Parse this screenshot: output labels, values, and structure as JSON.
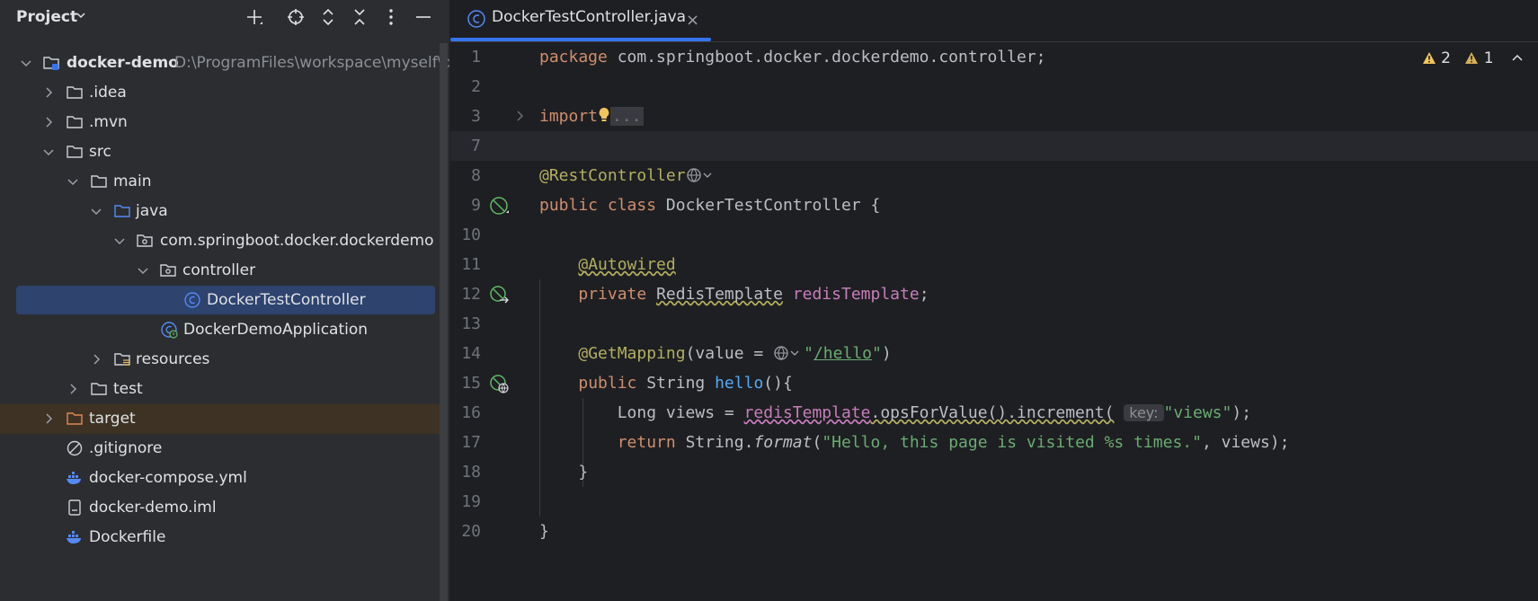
{
  "sidebar": {
    "title": "Project",
    "tree": [
      {
        "label": "docker-demo",
        "path": "D:\\ProgramFiles\\workspace\\myself\\doc",
        "icon": "module-folder-icon",
        "arrow": "down",
        "level": 0
      },
      {
        "label": ".idea",
        "icon": "folder-icon",
        "arrow": "right",
        "level": 1
      },
      {
        "label": ".mvn",
        "icon": "folder-icon",
        "arrow": "right",
        "level": 1
      },
      {
        "label": "src",
        "icon": "folder-icon",
        "arrow": "down",
        "level": 1
      },
      {
        "label": "main",
        "icon": "folder-icon",
        "arrow": "down",
        "level": 2
      },
      {
        "label": "java",
        "icon": "source-folder-icon",
        "arrow": "down",
        "level": 3
      },
      {
        "label": "com.springboot.docker.dockerdemo",
        "icon": "package-icon",
        "arrow": "down",
        "level": 4
      },
      {
        "label": "controller",
        "icon": "package-icon",
        "arrow": "down",
        "level": 5
      },
      {
        "label": "DockerTestController",
        "icon": "class-icon",
        "arrow": "none",
        "level": 6
      },
      {
        "label": "DockerDemoApplication",
        "icon": "spring-app-icon",
        "arrow": "none",
        "level": 5
      },
      {
        "label": "resources",
        "icon": "resources-folder-icon",
        "arrow": "right",
        "level": 3
      },
      {
        "label": "test",
        "icon": "folder-icon",
        "arrow": "right",
        "level": 2
      },
      {
        "label": "target",
        "icon": "excluded-folder-icon",
        "arrow": "right",
        "level": 1
      },
      {
        "label": ".gitignore",
        "icon": "gitignore-icon",
        "arrow": "none",
        "level": 1
      },
      {
        "label": "docker-compose.yml",
        "icon": "docker-icon",
        "arrow": "none",
        "level": 1
      },
      {
        "label": "docker-demo.iml",
        "icon": "iml-file-icon",
        "arrow": "none",
        "level": 1
      },
      {
        "label": "Dockerfile",
        "icon": "docker-icon",
        "arrow": "none",
        "level": 1
      }
    ]
  },
  "editor": {
    "tab_label": "DockerTestController.java",
    "tab_close": "×",
    "warnings": {
      "count_a": "2",
      "count_b": "1"
    },
    "lines": {
      "l1": {
        "num": "1",
        "kw": "package",
        "rest": " com.springboot.docker.dockerdemo.controller;"
      },
      "l2": {
        "num": "2"
      },
      "l3": {
        "num": "3",
        "kw": "import",
        "fold": "..."
      },
      "l7": {
        "num": "7"
      },
      "l8": {
        "num": "8",
        "ann": "@RestController"
      },
      "l9": {
        "num": "9",
        "kw1": "public",
        "kw2": "class",
        "name": " DockerTestController {"
      },
      "l10": {
        "num": "10"
      },
      "l11": {
        "num": "11",
        "ann": "@Autowired"
      },
      "l12": {
        "num": "12",
        "kw": "private",
        "type": "RedisTemplate",
        "field": "redisTemplate",
        "end": ";"
      },
      "l13": {
        "num": "13"
      },
      "l14": {
        "num": "14",
        "ann": "@GetMapping",
        "pre": "(value = ",
        "str_q1": "\"",
        "str_path": "/hello",
        "str_q2": "\"",
        "end": ")"
      },
      "l15": {
        "num": "15",
        "kw": "public",
        "type": " String ",
        "fn": "hello",
        "end": "(){"
      },
      "l16": {
        "num": "16",
        "pre": "Long views = ",
        "field": "redisTemplate",
        "mid": ".opsForValue().increment(",
        "hint": "key:",
        "str": "\"views\"",
        "end": ");"
      },
      "l17": {
        "num": "17",
        "kw": "return",
        "pre": " String.",
        "fn_it": "format",
        "open": "(",
        "str": "\"Hello, this page is visited %s times.\"",
        "end": ", views);"
      },
      "l18": {
        "num": "18",
        "code": "}"
      },
      "l19": {
        "num": "19"
      },
      "l20": {
        "num": "20",
        "code": "}"
      }
    }
  }
}
